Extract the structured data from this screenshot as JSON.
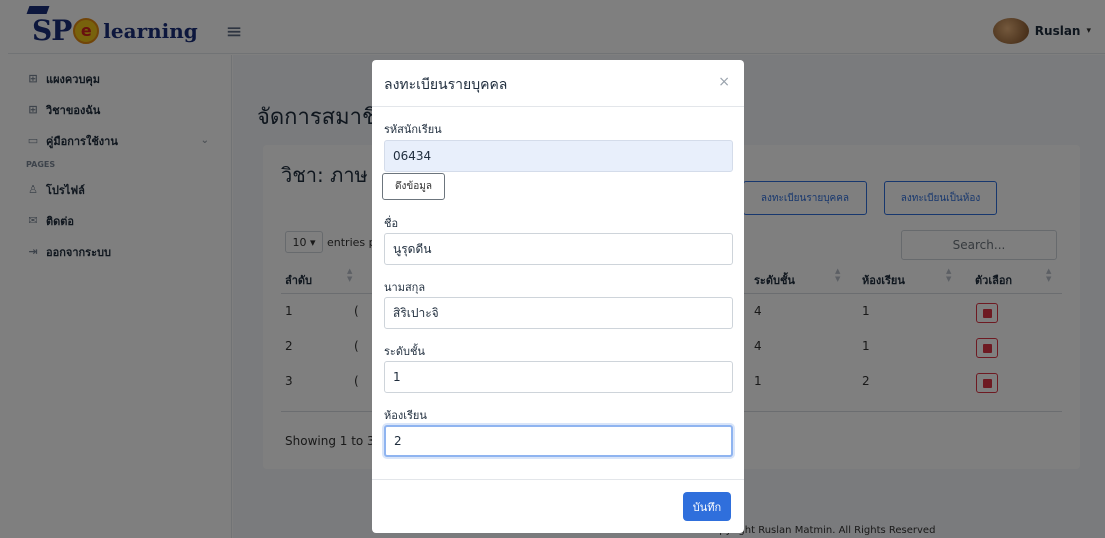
{
  "brand": {
    "sp": "SP",
    "circle": "e",
    "learning": "learning"
  },
  "user": {
    "name": "Ruslan"
  },
  "sidebar": {
    "items": [
      {
        "label": "แผงควบคุม",
        "icon": "grid-icon"
      },
      {
        "label": "วิชาของฉัน",
        "icon": "grid-icon"
      },
      {
        "label": "คู่มือการใช้งาน",
        "icon": "book-icon"
      }
    ],
    "header": "PAGES",
    "pages": [
      {
        "label": "โปรไฟล์",
        "icon": "user-icon"
      },
      {
        "label": "ติดต่อ",
        "icon": "mail-icon"
      },
      {
        "label": "ออกจากระบบ",
        "icon": "logout-icon"
      }
    ]
  },
  "main": {
    "title": "จัดการสมาชิ",
    "card_title": "วิชา: ภาษ",
    "btn_individual": "ลงทะเบียนรายบุคคล",
    "btn_class": "ลงทะเบียนเป็นห้อง",
    "entries_value": "10",
    "entries_suffix": "entries p",
    "search_placeholder": "Search...",
    "columns": {
      "order": "ลำดับ",
      "level": "ระดับชั้น",
      "room": "ห้องเรียน",
      "options": "ตัวเลือก"
    },
    "rows": [
      {
        "order": "1",
        "partial": "(",
        "level": "4",
        "room": "1"
      },
      {
        "order": "2",
        "partial": "(",
        "level": "4",
        "room": "1"
      },
      {
        "order": "3",
        "partial": "(",
        "level": "1",
        "room": "2"
      }
    ],
    "showing": "Showing 1 to 3 (",
    "footer": "© Copyright Ruslan Matmin. All Rights Reserved"
  },
  "modal": {
    "title": "ลงทะเบียนรายบุคคล",
    "close": "×",
    "student_id_label": "รหัสนักเรียน",
    "student_id_value": "06434",
    "fetch_label": "ดึงข้อมูล",
    "first_name_label": "ชื่อ",
    "first_name_value": "นูรุดดีน",
    "last_name_label": "นามสกุล",
    "last_name_value": "สิริเปาะจิ",
    "level_label": "ระดับชั้น",
    "level_value": "1",
    "room_label": "ห้องเรียน",
    "room_value": "2",
    "save_label": "บันทึก"
  }
}
